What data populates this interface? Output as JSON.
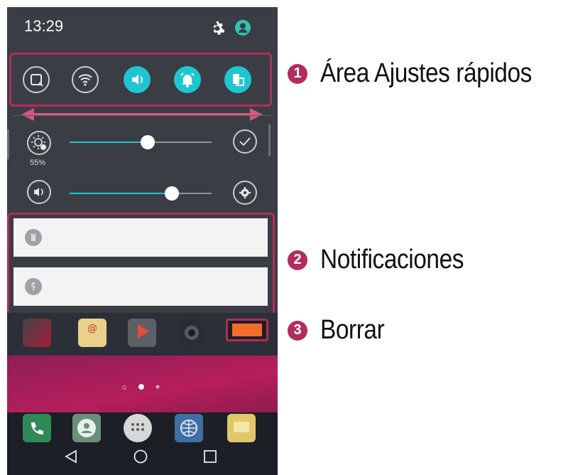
{
  "status_bar": {
    "time": "13:29",
    "icons": [
      "gear-icon",
      "user-icon"
    ]
  },
  "quick_settings": {
    "buttons": [
      {
        "name": "capture-icon",
        "state": "off"
      },
      {
        "name": "wifi-icon",
        "state": "off"
      },
      {
        "name": "sound-icon",
        "state": "on"
      },
      {
        "name": "alarm-icon",
        "state": "on"
      },
      {
        "name": "screen-rotation-icon",
        "state": "on"
      }
    ]
  },
  "sliders": {
    "brightness": {
      "percent_label": "55%",
      "value": 0.55,
      "icon": "brightness-icon",
      "end_icon": "check-icon"
    },
    "volume": {
      "value": 0.72,
      "icon": "sound-icon",
      "end_icon": "settings-icon"
    }
  },
  "notifications": [
    {
      "icon": "trash-icon"
    },
    {
      "icon": "usb-icon"
    }
  ],
  "home": {
    "clear_button_icon": "clear-icon",
    "page_dots": 3,
    "active_dot": 1
  },
  "callouts": [
    {
      "number": "1",
      "label": "Área Ajustes rápidos"
    },
    {
      "number": "2",
      "label": "Notificaciones"
    },
    {
      "number": "3",
      "label": "Borrar"
    }
  ],
  "colors": {
    "accent": "#1ec6d2",
    "callout": "#b32c5c",
    "clear_button": "#f36d2a"
  }
}
